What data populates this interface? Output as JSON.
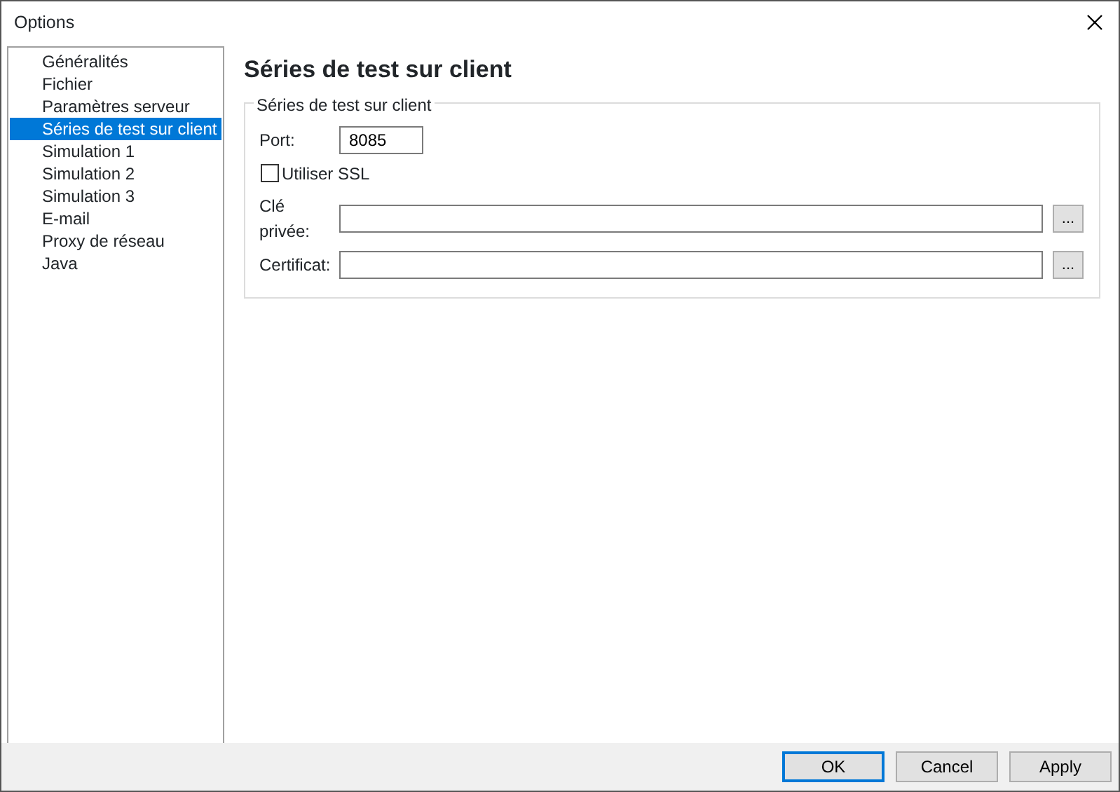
{
  "window": {
    "title": "Options"
  },
  "sidebar": {
    "items": [
      {
        "label": "Généralités",
        "selected": false
      },
      {
        "label": "Fichier",
        "selected": false
      },
      {
        "label": "Paramètres serveur",
        "selected": false
      },
      {
        "label": "Séries de test sur client",
        "selected": true
      },
      {
        "label": "Simulation 1",
        "selected": false
      },
      {
        "label": "Simulation 2",
        "selected": false
      },
      {
        "label": "Simulation 3",
        "selected": false
      },
      {
        "label": "E-mail",
        "selected": false
      },
      {
        "label": "Proxy de réseau",
        "selected": false
      },
      {
        "label": "Java",
        "selected": false
      }
    ]
  },
  "page": {
    "heading": "Séries de test sur client",
    "group": {
      "legend": "Séries de test sur client",
      "port": {
        "label": "Port:",
        "value": "8085"
      },
      "ssl": {
        "label": "Utiliser SSL",
        "checked": false
      },
      "files": [
        {
          "label": "Clé privée:",
          "browse": "..."
        },
        {
          "label": "Certificat:",
          "browse": "..."
        }
      ]
    }
  },
  "buttons": [
    {
      "label": "OK",
      "default": true
    },
    {
      "label": "Cancel",
      "default": false
    },
    {
      "label": "Apply",
      "default": false
    }
  ]
}
